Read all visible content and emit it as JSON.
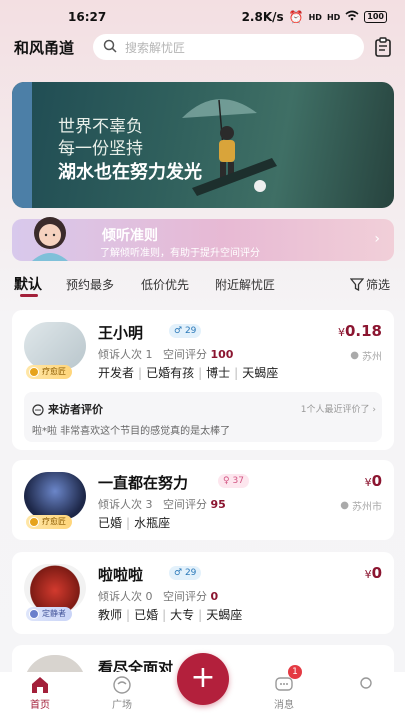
{
  "status": {
    "time": "16:27",
    "net_speed": "2.8K/s",
    "signal1": "HD",
    "signal2": "HD",
    "battery": "100"
  },
  "header": {
    "logo": "和风甬道",
    "search_placeholder": "搜索解忧匠"
  },
  "banner": {
    "line1": "世界不辜负",
    "line2": "每一份坚持",
    "line3": "湖水也在努力发光"
  },
  "rules": {
    "title": "倾听准则",
    "subtitle": "了解倾听准则，有助于提升空间评分"
  },
  "sort": {
    "items": [
      "默认",
      "预约最多",
      "低价优先",
      "附近解忧匠"
    ],
    "filter": "筛选"
  },
  "cards": [
    {
      "name": "王小明",
      "gender": "♂",
      "age": "29",
      "price_symbol": "¥",
      "price": "0.18",
      "location": "苏州",
      "badge": "疗愈匠",
      "visits_label": "倾诉人次",
      "visits": "1",
      "score_label": "空间评分",
      "score": "100",
      "tags": [
        "开发者",
        "已婚有孩",
        "博士",
        "天蝎座"
      ],
      "review": {
        "title": "来访者评价",
        "count": "1个人最近评价了",
        "text": "啦*啦 非常喜欢这个节目的感觉真的是太棒了"
      }
    },
    {
      "name": "一直都在努力",
      "gender": "♀",
      "age": "37",
      "price_symbol": "¥",
      "price": "0",
      "location": "苏州市",
      "badge": "疗愈匠",
      "visits_label": "倾诉人次",
      "visits": "3",
      "score_label": "空间评分",
      "score": "95",
      "tags": [
        "已婚",
        "水瓶座"
      ]
    },
    {
      "name": "啦啦啦",
      "gender": "♂",
      "age": "29",
      "price_symbol": "¥",
      "price": "0",
      "badge": "定静者",
      "visits_label": "倾诉人次",
      "visits": "0",
      "score_label": "空间评分",
      "score": "0",
      "tags": [
        "教师",
        "已婚",
        "大专",
        "天蝎座"
      ]
    }
  ],
  "peek_card": {
    "name": "看尽全面对"
  },
  "tabbar": {
    "home": "首页",
    "square": "广场",
    "messages": "消息",
    "message_count": "1"
  },
  "colors": {
    "accent": "#a3203a",
    "price": "#8b1530"
  }
}
